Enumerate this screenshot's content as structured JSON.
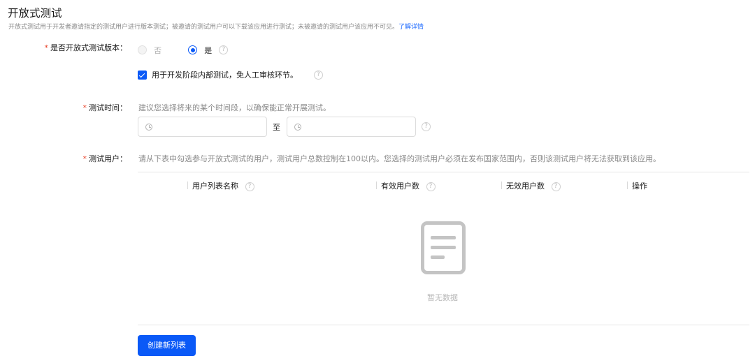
{
  "header": {
    "title": "开放式测试",
    "description": "开放式测试用于开发者邀请指定的测试用户进行版本测试；被邀请的测试用户可以下载该应用进行测试；未被邀请的测试用户该应用不可见。",
    "learn_more": "了解详情"
  },
  "open_test": {
    "label": "是否开放式测试版本：",
    "option_no": "否",
    "option_yes": "是",
    "selected": "是",
    "help": "?"
  },
  "internal_test": {
    "checked": true,
    "label": "用于开发阶段内部测试，免人工审核环节。",
    "help": "?"
  },
  "test_time": {
    "label": "测试时间：",
    "hint": "建议您选择将来的某个时间段，以确保能正常开展测试。",
    "start_placeholder": "",
    "end_placeholder": "",
    "separator": "至",
    "help": "?"
  },
  "test_users": {
    "label": "测试用户：",
    "hint": "请从下表中勾选参与开放式测试的用户，测试用户总数控制在100以内。您选择的测试用户必须在发布国家范围内，否则该测试用户将无法获取到该应用。",
    "table": {
      "columns": [
        {
          "label": "用户列表名称",
          "help": "?"
        },
        {
          "label": "有效用户数",
          "help": "?"
        },
        {
          "label": "无效用户数",
          "help": "?"
        },
        {
          "label": "操作"
        }
      ],
      "rows": [],
      "empty_text": "暂无数据"
    },
    "create_button": "创建新列表"
  },
  "colors": {
    "primary": "#0a59f7",
    "link": "#256fff",
    "required": "#e84026"
  },
  "icons": [
    "help-icon",
    "clock-icon",
    "empty-document-icon",
    "check-icon"
  ]
}
